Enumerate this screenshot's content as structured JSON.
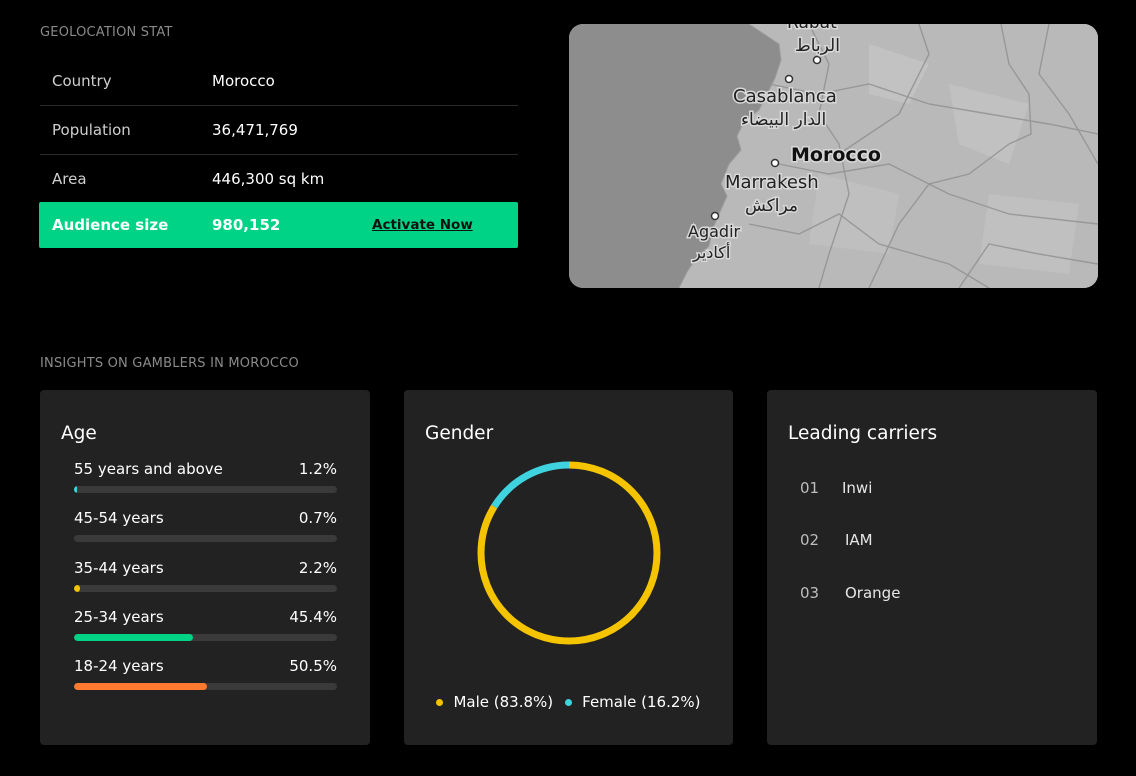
{
  "geo": {
    "section_label": "GEOLOCATION STAT",
    "rows": [
      {
        "key": "Country",
        "value": "Morocco"
      },
      {
        "key": "Population",
        "value": "36,471,769"
      },
      {
        "key": "Area",
        "value": "446,300 sq km"
      }
    ],
    "audience": {
      "key": "Audience size",
      "value": "980,152",
      "cta": "Activate Now"
    },
    "accent_color": "#00d385"
  },
  "map": {
    "labels": {
      "rabat_latin": "Rabat",
      "rabat_arabic": "الرباط",
      "casablanca_latin": "Casablanca",
      "casablanca_arabic": "الدار البيضاء",
      "country": "Morocco",
      "marrakesh_latin": "Marrakesh",
      "marrakesh_arabic": "مراكش",
      "agadir_latin": "Agadir",
      "agadir_arabic": "أكادير"
    }
  },
  "insights": {
    "section_label": "INSIGHTS ON GAMBLERS IN MOROCCO",
    "age": {
      "title": "Age",
      "rows": [
        {
          "label": "55 years and above",
          "pct_text": "1.2%",
          "value": 1.2,
          "color": "#3fd3e0"
        },
        {
          "label": "45-54 years",
          "pct_text": "0.7%",
          "value": 0.7,
          "color": "#3a3a3a"
        },
        {
          "label": "35-44 years",
          "pct_text": "2.2%",
          "value": 2.2,
          "color": "#f5c400"
        },
        {
          "label": "25-34 years",
          "pct_text": "45.4%",
          "value": 45.4,
          "color": "#00d385"
        },
        {
          "label": "18-24 years",
          "pct_text": "50.5%",
          "value": 50.5,
          "color": "#ff7a30"
        }
      ]
    },
    "gender": {
      "title": "Gender",
      "segments": [
        {
          "label": "Male (83.8%)",
          "value": 83.8,
          "color": "#f5c400"
        },
        {
          "label": "Female (16.2%)",
          "value": 16.2,
          "color": "#3fd3e0"
        }
      ]
    },
    "carriers": {
      "title": "Leading carriers",
      "items": [
        {
          "num": "01",
          "name": "Inwi"
        },
        {
          "num": "02",
          "name": "IAM"
        },
        {
          "num": "03",
          "name": "Orange"
        }
      ]
    }
  }
}
